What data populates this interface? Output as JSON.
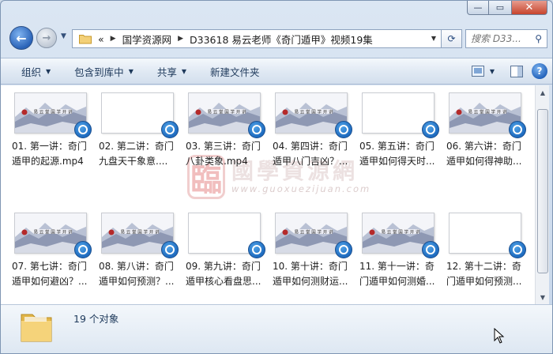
{
  "address": {
    "prefix": "«",
    "crumbs": [
      "国学资源网",
      "D33618 易云老师《奇门遁甲》视频19集"
    ]
  },
  "search": {
    "placeholder": "搜索 D33..."
  },
  "toolbar": {
    "organize": "组织",
    "include_library": "包含到库中",
    "share": "共享",
    "new_folder": "新建文件夹"
  },
  "watermark": {
    "seal": "臨",
    "name": "國學資源網",
    "url": "www.guoxuezijuan.com"
  },
  "files": [
    {
      "line1": "01. 第一讲：奇门",
      "line2": "遁甲的起源.mp4",
      "thumb": "scene"
    },
    {
      "line1": "02. 第二讲：奇门",
      "line2": "九盘天干象意....",
      "thumb": "blank"
    },
    {
      "line1": "03. 第三讲：奇门",
      "line2": "八卦类象.mp4",
      "thumb": "scene"
    },
    {
      "line1": "04. 第四讲：奇门",
      "line2": "遁甲八门吉凶？...",
      "thumb": "scene"
    },
    {
      "line1": "05. 第五讲：奇门",
      "line2": "遁甲如何得天时...",
      "thumb": "blank"
    },
    {
      "line1": "06. 第六讲：奇门",
      "line2": "遁甲如何得神助...",
      "thumb": "scene"
    },
    {
      "line1": "07. 第七讲：奇门",
      "line2": "遁甲如何避凶？...",
      "thumb": "scene"
    },
    {
      "line1": "08. 第八讲：奇门",
      "line2": "遁甲如何预测？...",
      "thumb": "scene"
    },
    {
      "line1": "09. 第九讲：奇门",
      "line2": "遁甲核心看盘思...",
      "thumb": "blank"
    },
    {
      "line1": "10. 第十讲：奇门",
      "line2": "遁甲如何测财运...",
      "thumb": "scene"
    },
    {
      "line1": "11. 第十一讲：奇",
      "line2": "门遁甲如何测婚...",
      "thumb": "scene"
    },
    {
      "line1": "12. 第十二讲：奇",
      "line2": "门遁甲如何预测...",
      "thumb": "blank"
    }
  ],
  "status": {
    "count": "19 个对象"
  },
  "colors": {
    "accent": "#1f6cc0",
    "toolbar_text": "#1e395b"
  }
}
